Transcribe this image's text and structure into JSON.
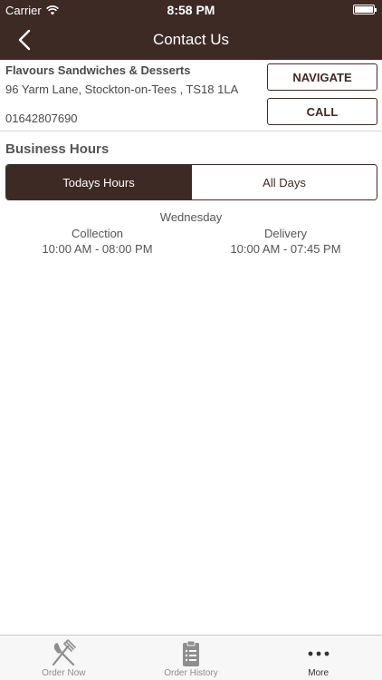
{
  "status_bar": {
    "carrier": "Carrier",
    "time": "8:58 PM"
  },
  "nav": {
    "title": "Contact Us",
    "back_icon": "chevron-left-icon"
  },
  "store": {
    "name": "Flavours Sandwiches & Desserts",
    "address": "96 Yarm Lane, Stockton-on-Tees , TS18 1LA",
    "phone": "01642807690",
    "navigate_label": "NAVIGATE",
    "call_label": "CALL"
  },
  "business_hours": {
    "title": "Business Hours",
    "tabs": [
      {
        "label": "Todays Hours",
        "active": true
      },
      {
        "label": "All Days",
        "active": false
      }
    ],
    "day": "Wednesday",
    "collection": {
      "label": "Collection",
      "hours": "10:00 AM - 08:00 PM"
    },
    "delivery": {
      "label": "Delivery",
      "hours": "10:00 AM - 07:45 PM"
    }
  },
  "tab_bar": {
    "items": [
      {
        "label": "Order Now",
        "icon": "fork-knife-icon",
        "active": false
      },
      {
        "label": "Order History",
        "icon": "clipboard-icon",
        "active": false
      },
      {
        "label": "More",
        "icon": "more-icon",
        "active": true
      }
    ]
  },
  "colors": {
    "brand": "#3d2a25",
    "tabbar_bg": "#f7f7f7",
    "inactive_tab": "#8e8e8e"
  }
}
